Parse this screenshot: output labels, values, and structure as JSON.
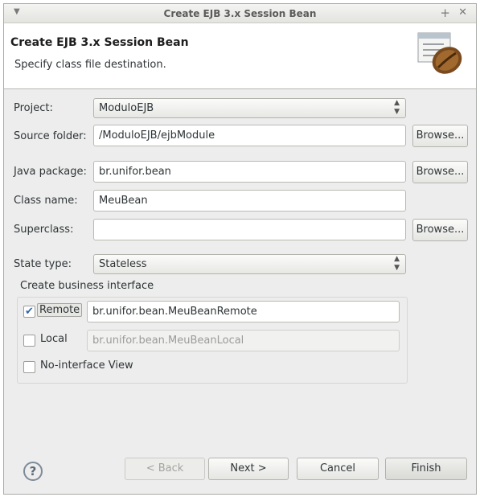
{
  "window": {
    "title": "Create EJB 3.x Session Bean",
    "menu_icon": "chevron-down-icon",
    "plus_icon": "plus-icon",
    "close_icon": "close-icon"
  },
  "banner": {
    "title": "Create EJB 3.x Session Bean",
    "subtitle": "Specify class file destination.",
    "image_icon": "coffee-bean-icon"
  },
  "form": {
    "project": {
      "label": "Project:",
      "value": "ModuloEJB"
    },
    "source_folder": {
      "label": "Source folder:",
      "value": "/ModuloEJB/ejbModule",
      "browse": "Browse..."
    },
    "java_package": {
      "label": "Java package:",
      "value": "br.unifor.bean",
      "browse": "Browse..."
    },
    "class_name": {
      "label": "Class name:",
      "value": "MeuBean"
    },
    "superclass": {
      "label": "Superclass:",
      "value": "",
      "browse": "Browse..."
    },
    "state_type": {
      "label": "State type:",
      "value": "Stateless"
    }
  },
  "business_interface": {
    "title": "Create business interface",
    "remote": {
      "label": "Remote",
      "checked": true,
      "value": "br.unifor.bean.MeuBeanRemote"
    },
    "local": {
      "label": "Local",
      "checked": false,
      "value": "br.unifor.bean.MeuBeanLocal"
    },
    "no_interface": {
      "label": "No-interface View",
      "checked": false
    }
  },
  "footer": {
    "help": "?",
    "back": "< Back",
    "next": "Next >",
    "cancel": "Cancel",
    "finish": "Finish"
  },
  "colors": {
    "check_mark": "#3465a4",
    "background": "#ededed"
  }
}
